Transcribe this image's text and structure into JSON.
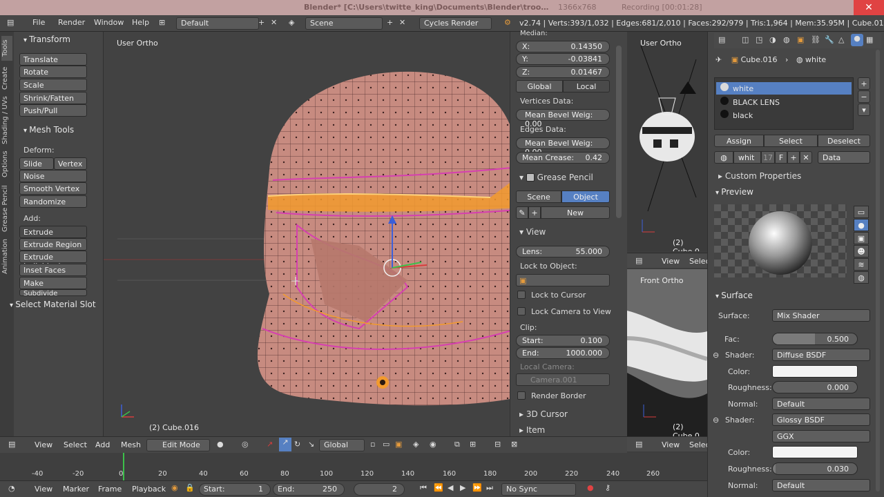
{
  "titlebar": {
    "title": "Blender* [C:\\Users\\twitte_king\\Documents\\Blender\\troo…",
    "recording": "Recording [00:01:28]",
    "resolution": "1366x768"
  },
  "topbar": {
    "menus": [
      "File",
      "Render",
      "Window",
      "Help"
    ],
    "layout": "Default",
    "scene": "Scene",
    "engine": "Cycles Render",
    "stats": "v2.74 | Verts:393/1,032 | Edges:681/2,010 | Faces:292/979 | Tris:1,964 | Mem:35.95M | Cube.016"
  },
  "toolshelf": {
    "tabs": [
      "Tools",
      "Create",
      "Shading / UVs",
      "Options",
      "Grease Pencil",
      "Animation"
    ],
    "transform_title": "Transform",
    "transform": [
      "Translate",
      "Rotate",
      "Scale",
      "Shrink/Fatten",
      "Push/Pull"
    ],
    "mesh_tools_title": "Mesh Tools",
    "deform_label": "Deform:",
    "slide_edge": "Slide Ed",
    "vertex": "Vertex",
    "deform": [
      "Noise",
      "Smooth Vertex",
      "Randomize"
    ],
    "add_label": "Add:",
    "extrude": "Extrude",
    "add": [
      "Extrude Region",
      "Extrude Individual",
      "Inset Faces",
      "Make Edge/Face",
      "Subdivide"
    ],
    "select_material_slot": "Select Material Slot"
  },
  "viewport": {
    "view_label": "User Ortho",
    "object_label": "(2) Cube.016"
  },
  "npanel": {
    "median_label": "Median:",
    "x_label": "X:",
    "x": "0.14350",
    "y_label": "Y:",
    "y": "-0.03841",
    "z_label": "Z:",
    "z": "0.01467",
    "global": "Global",
    "local": "Local",
    "vertices_data": "Vertices Data:",
    "mean_bevel_v": "Mean Bevel Weig: 0.00",
    "edges_data": "Edges Data:",
    "mean_bevel_e": "Mean Bevel Weig: 0.00",
    "mean_crease_label": "Mean Crease:",
    "mean_crease": "0.42",
    "grease_pencil": "Grease Pencil",
    "scene": "Scene",
    "object": "Object",
    "new": "New",
    "view_title": "View",
    "lens_label": "Lens:",
    "lens": "55.000",
    "lock_to_object": "Lock to Object:",
    "lock_to_cursor": "Lock to Cursor",
    "lock_camera_to_view": "Lock Camera to View",
    "clip_label": "Clip:",
    "start_label": "Start:",
    "start": "0.100",
    "end_label": "End:",
    "end": "1000.000",
    "local_camera": "Local Camera:",
    "camera": "Camera.001",
    "render_border": "Render Border",
    "cursor_3d": "3D Cursor",
    "item": "Item"
  },
  "right_views": {
    "top_label": "User Ortho",
    "top_object": "(2) Cube.0",
    "bottom_label": "Front Ortho",
    "bottom_object": "(2) Cube.0",
    "view": "View",
    "select": "Selec"
  },
  "properties": {
    "breadcrumb_object": "Cube.016",
    "breadcrumb_material": "white",
    "materials": [
      {
        "name": "white",
        "selected": true,
        "color": "#d9d9d9"
      },
      {
        "name": "BLACK LENS",
        "selected": false,
        "color": "#111111"
      },
      {
        "name": "black",
        "selected": false,
        "color": "#111111"
      }
    ],
    "assign": "Assign",
    "select": "Select",
    "deselect": "Deselect",
    "material_name": "whit",
    "users": "17",
    "fake": "F",
    "data": "Data",
    "custom_properties": "Custom Properties",
    "preview": "Preview",
    "surface_title": "Surface",
    "surface_label": "Surface:",
    "surface": "Mix Shader",
    "fac_label": "Fac:",
    "fac": "0.500",
    "shader_label": "Shader:",
    "shader1": "Diffuse BSDF",
    "color_label": "Color:",
    "roughness_label": "Roughness:",
    "roughness1": "0.000",
    "normal_label": "Normal:",
    "normal1": "Default",
    "shader2": "Glossy BSDF",
    "distribution": "GGX",
    "roughness2": "0.030",
    "normal2": "Default"
  },
  "viewport_header": {
    "view": "View",
    "select": "Select",
    "add": "Add",
    "mesh": "Mesh",
    "mode": "Edit Mode",
    "orientation": "Global"
  },
  "timeline": {
    "ticks": [
      "-40",
      "-20",
      "0",
      "20",
      "40",
      "60",
      "80",
      "100",
      "120",
      "140",
      "160",
      "180",
      "200",
      "220",
      "240",
      "260"
    ],
    "view": "View",
    "marker": "Marker",
    "frame": "Frame",
    "playback": "Playback",
    "start_label": "Start:",
    "start": "1",
    "end_label": "End:",
    "end": "250",
    "current": "2",
    "sync": "No Sync"
  },
  "colors": {
    "accent": "#5680c2",
    "selection_orange": "#f29a2e",
    "helmet": "#c78b80"
  }
}
